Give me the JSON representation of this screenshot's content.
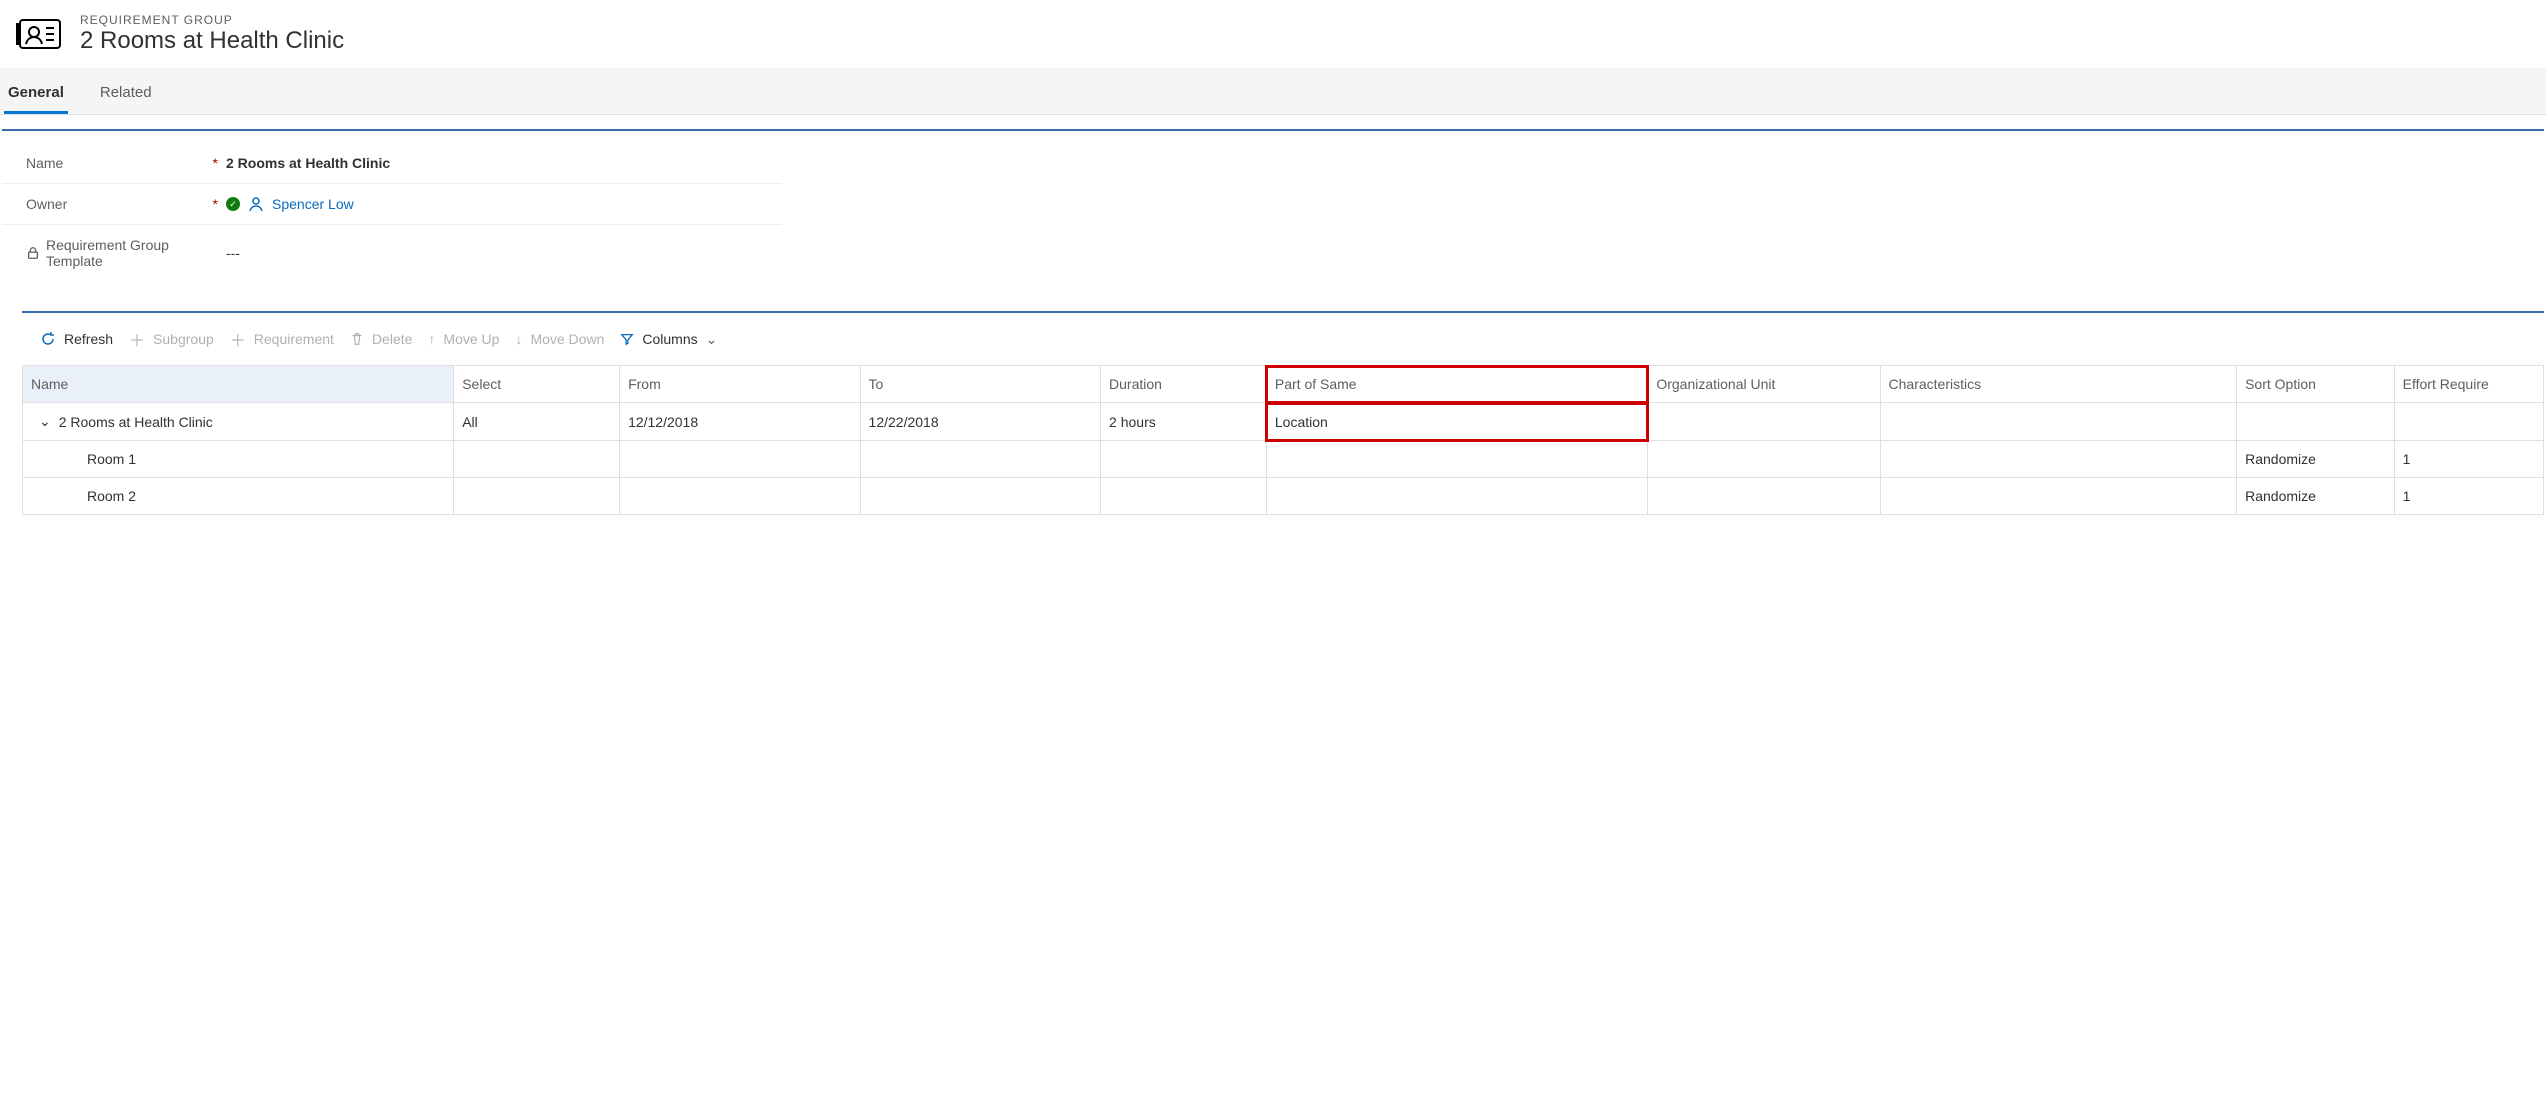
{
  "header": {
    "entity_type": "REQUIREMENT GROUP",
    "title": "2 Rooms at Health Clinic"
  },
  "tabs": {
    "general": "General",
    "related": "Related"
  },
  "form": {
    "name_label": "Name",
    "name_value": "2 Rooms at Health Clinic",
    "owner_label": "Owner",
    "owner_value": "Spencer Low",
    "template_label": "Requirement Group Template",
    "template_value": "---"
  },
  "toolbar": {
    "refresh": "Refresh",
    "subgroup": "Subgroup",
    "requirement": "Requirement",
    "delete": "Delete",
    "move_up": "Move Up",
    "move_down": "Move Down",
    "columns": "Columns"
  },
  "grid": {
    "headers": {
      "name": "Name",
      "select": "Select",
      "from": "From",
      "to": "To",
      "duration": "Duration",
      "part_of_same": "Part of Same",
      "org_unit": "Organizational Unit",
      "characteristics": "Characteristics",
      "sort_option": "Sort Option",
      "effort_required": "Effort Require"
    },
    "rows": [
      {
        "name": "2 Rooms at Health Clinic",
        "select": "All",
        "from": "12/12/2018",
        "to": "12/22/2018",
        "duration": "2 hours",
        "part_of_same": "Location",
        "org_unit": "",
        "characteristics": "",
        "sort_option": "",
        "effort_required": "",
        "level": 1
      },
      {
        "name": "Room 1",
        "select": "",
        "from": "",
        "to": "",
        "duration": "",
        "part_of_same": "",
        "org_unit": "",
        "characteristics": "",
        "sort_option": "Randomize",
        "effort_required": "1",
        "level": 2
      },
      {
        "name": "Room 2",
        "select": "",
        "from": "",
        "to": "",
        "duration": "",
        "part_of_same": "",
        "org_unit": "",
        "characteristics": "",
        "sort_option": "Randomize",
        "effort_required": "1",
        "level": 2
      }
    ]
  }
}
